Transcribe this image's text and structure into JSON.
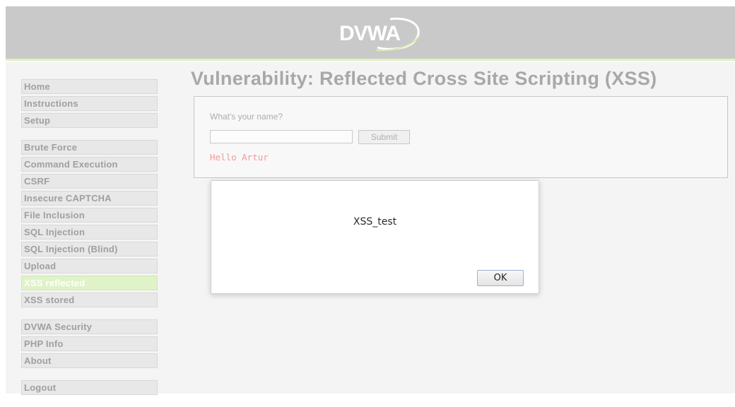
{
  "header": {
    "logo_text": "DVWA",
    "colors": {
      "header_bg": "#c9c9c9",
      "accent": "#e0f0c0"
    }
  },
  "menu": {
    "groups": [
      {
        "items": [
          {
            "label": "Home"
          },
          {
            "label": "Instructions"
          },
          {
            "label": "Setup"
          }
        ]
      },
      {
        "items": [
          {
            "label": "Brute Force"
          },
          {
            "label": "Command Execution"
          },
          {
            "label": "CSRF"
          },
          {
            "label": "Insecure CAPTCHA"
          },
          {
            "label": "File Inclusion"
          },
          {
            "label": "SQL Injection"
          },
          {
            "label": "SQL Injection (Blind)"
          },
          {
            "label": "Upload"
          },
          {
            "label": "XSS reflected",
            "selected": true
          },
          {
            "label": "XSS stored"
          }
        ]
      },
      {
        "items": [
          {
            "label": "DVWA Security"
          },
          {
            "label": "PHP Info"
          },
          {
            "label": "About"
          }
        ]
      },
      {
        "items": [
          {
            "label": "Logout"
          }
        ]
      }
    ]
  },
  "main": {
    "title": "Vulnerability: Reflected Cross Site Scripting (XSS)",
    "form": {
      "label": "What's your name?",
      "input_value": "",
      "submit_label": "Submit",
      "output": "Hello Artur"
    }
  },
  "alert": {
    "message": "XSS_test",
    "ok_label": "OK"
  }
}
